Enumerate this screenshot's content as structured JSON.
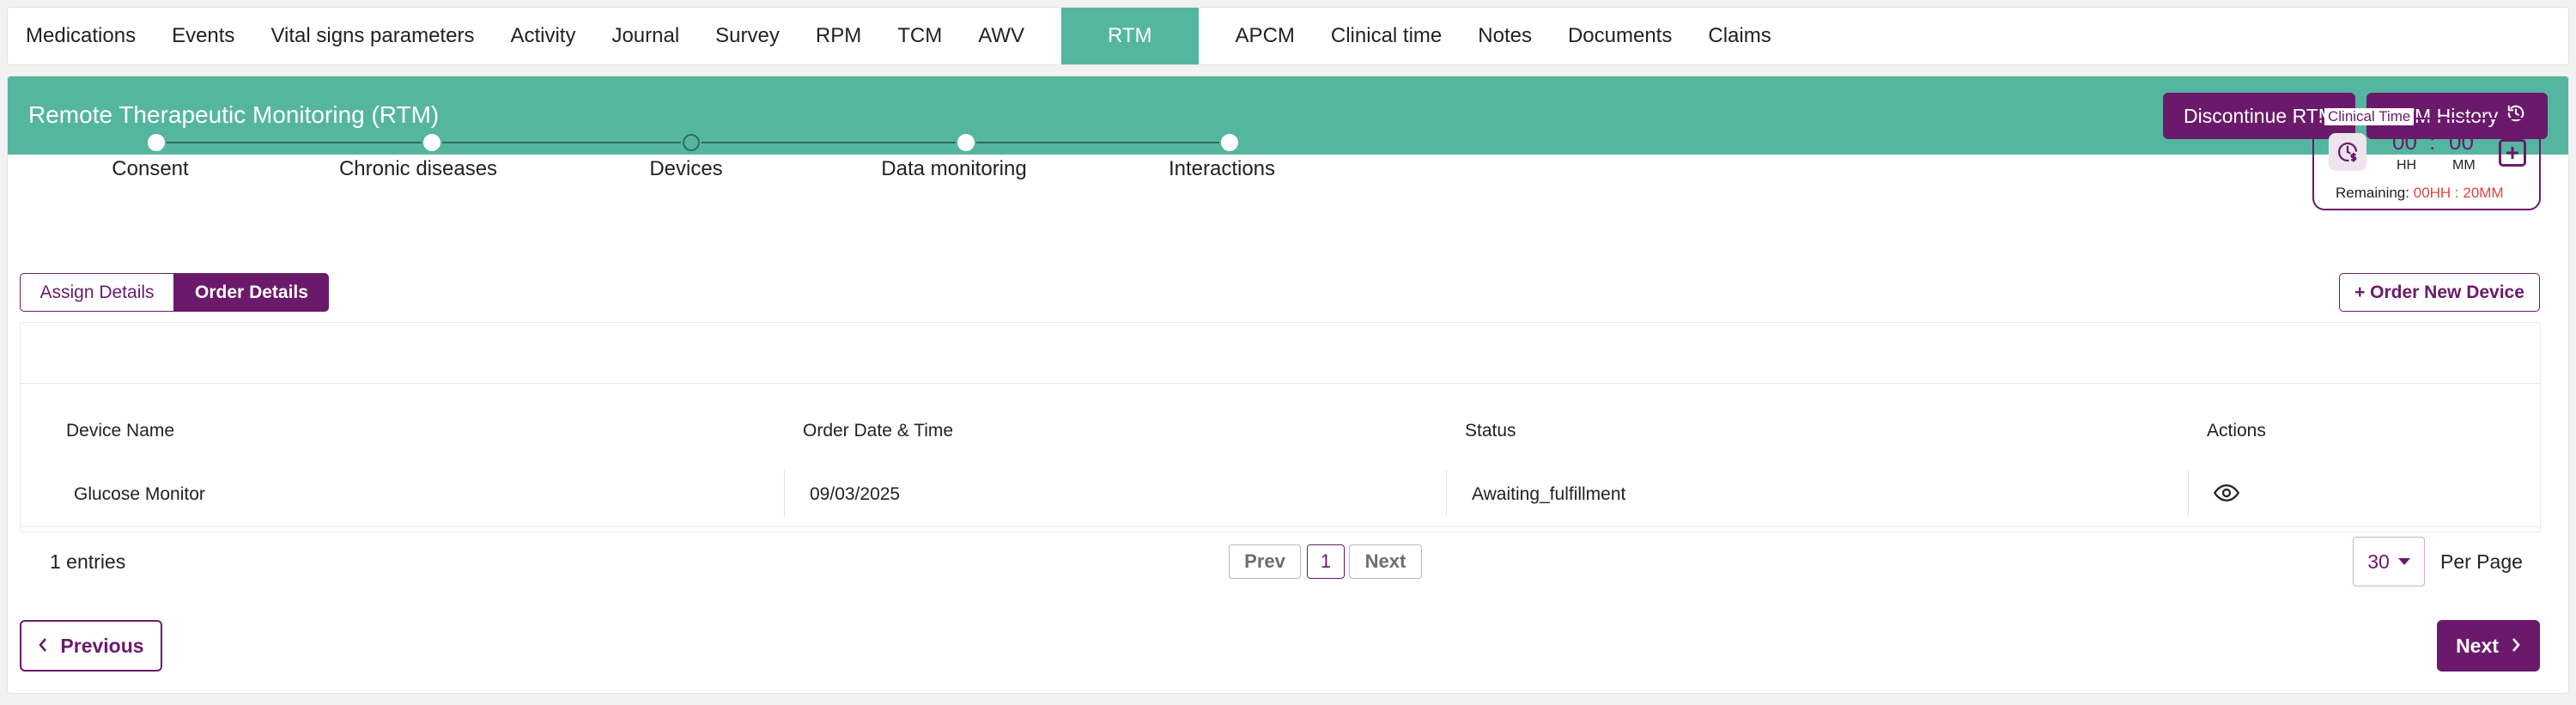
{
  "nav": {
    "items": [
      "Medications",
      "Events",
      "Vital signs parameters",
      "Activity",
      "Journal",
      "Survey",
      "RPM",
      "TCM",
      "AWV",
      "RTM",
      "APCM",
      "Clinical time",
      "Notes",
      "Documents",
      "Claims"
    ],
    "active": "RTM"
  },
  "banner": {
    "title": "Remote Therapeutic Monitoring (RTM)",
    "discontinue_label": "Discontinue RTM",
    "history_label": "RTM History"
  },
  "stepper": {
    "steps": [
      "Consent",
      "Chronic diseases",
      "Devices",
      "Data monitoring",
      "Interactions"
    ],
    "active_index": 2
  },
  "clinical_time": {
    "legend": "Clinical Time",
    "hours": "00",
    "minutes": "00",
    "separator": ":",
    "hours_unit": "HH",
    "minutes_unit": "MM",
    "remaining_label": "Remaining:",
    "remaining_value": "00HH : 20MM"
  },
  "subtabs": {
    "assign": "Assign Details",
    "order": "Order Details",
    "active": "order"
  },
  "order_new_label": "+ Order New Device",
  "table": {
    "columns": [
      "Device Name",
      "Order Date & Time",
      "Status",
      "Actions"
    ],
    "rows": [
      {
        "device": "Glucose Monitor",
        "date": "09/03/2025",
        "status": "Awaiting_fulfillment"
      }
    ]
  },
  "pagination": {
    "entries": "1 entries",
    "prev": "Prev",
    "current": "1",
    "next": "Next",
    "per_page": "30",
    "per_page_label": "Per Page"
  },
  "footer": {
    "previous": "Previous",
    "next": "Next"
  },
  "colors": {
    "teal": "#55b6a0",
    "purple": "#6b1a6b",
    "remaining": "#e0453a"
  }
}
